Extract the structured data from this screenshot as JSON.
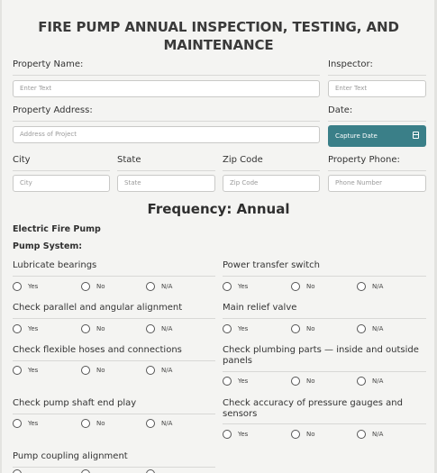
{
  "title": "FIRE PUMP ANNUAL INSPECTION, TESTING, AND MAINTENANCE",
  "fields": {
    "property_name": {
      "label": "Property Name:",
      "placeholder": "Enter Text"
    },
    "inspector": {
      "label": "Inspector:",
      "placeholder": "Enter Text"
    },
    "property_address": {
      "label": "Property Address:",
      "placeholder": "Address of Project"
    },
    "date": {
      "label": "Date:",
      "button": "Capture Date"
    },
    "city": {
      "label": "City",
      "placeholder": "City"
    },
    "state": {
      "label": "State",
      "placeholder": "State"
    },
    "zip": {
      "label": "Zip Code",
      "placeholder": "Zip Code"
    },
    "phone": {
      "label": "Property Phone:",
      "placeholder": "Phone Number"
    }
  },
  "frequency": "Frequency: Annual",
  "section_title": "Electric Fire Pump",
  "subsection_title": "Pump System:",
  "options": [
    "Yes",
    "No",
    "N/A"
  ],
  "questions": [
    "Lubricate bearings",
    "Power transfer switch",
    "Check parallel and angular alignment",
    "Main relief valve",
    "Check flexible hoses and connections",
    "Check plumbing parts — inside and outside panels",
    "Check pump shaft end play",
    "Check accuracy of pressure gauges and sensors",
    "Pump coupling alignment"
  ],
  "colors": {
    "accent": "#3a7f88",
    "background": "#f4f4f2"
  }
}
